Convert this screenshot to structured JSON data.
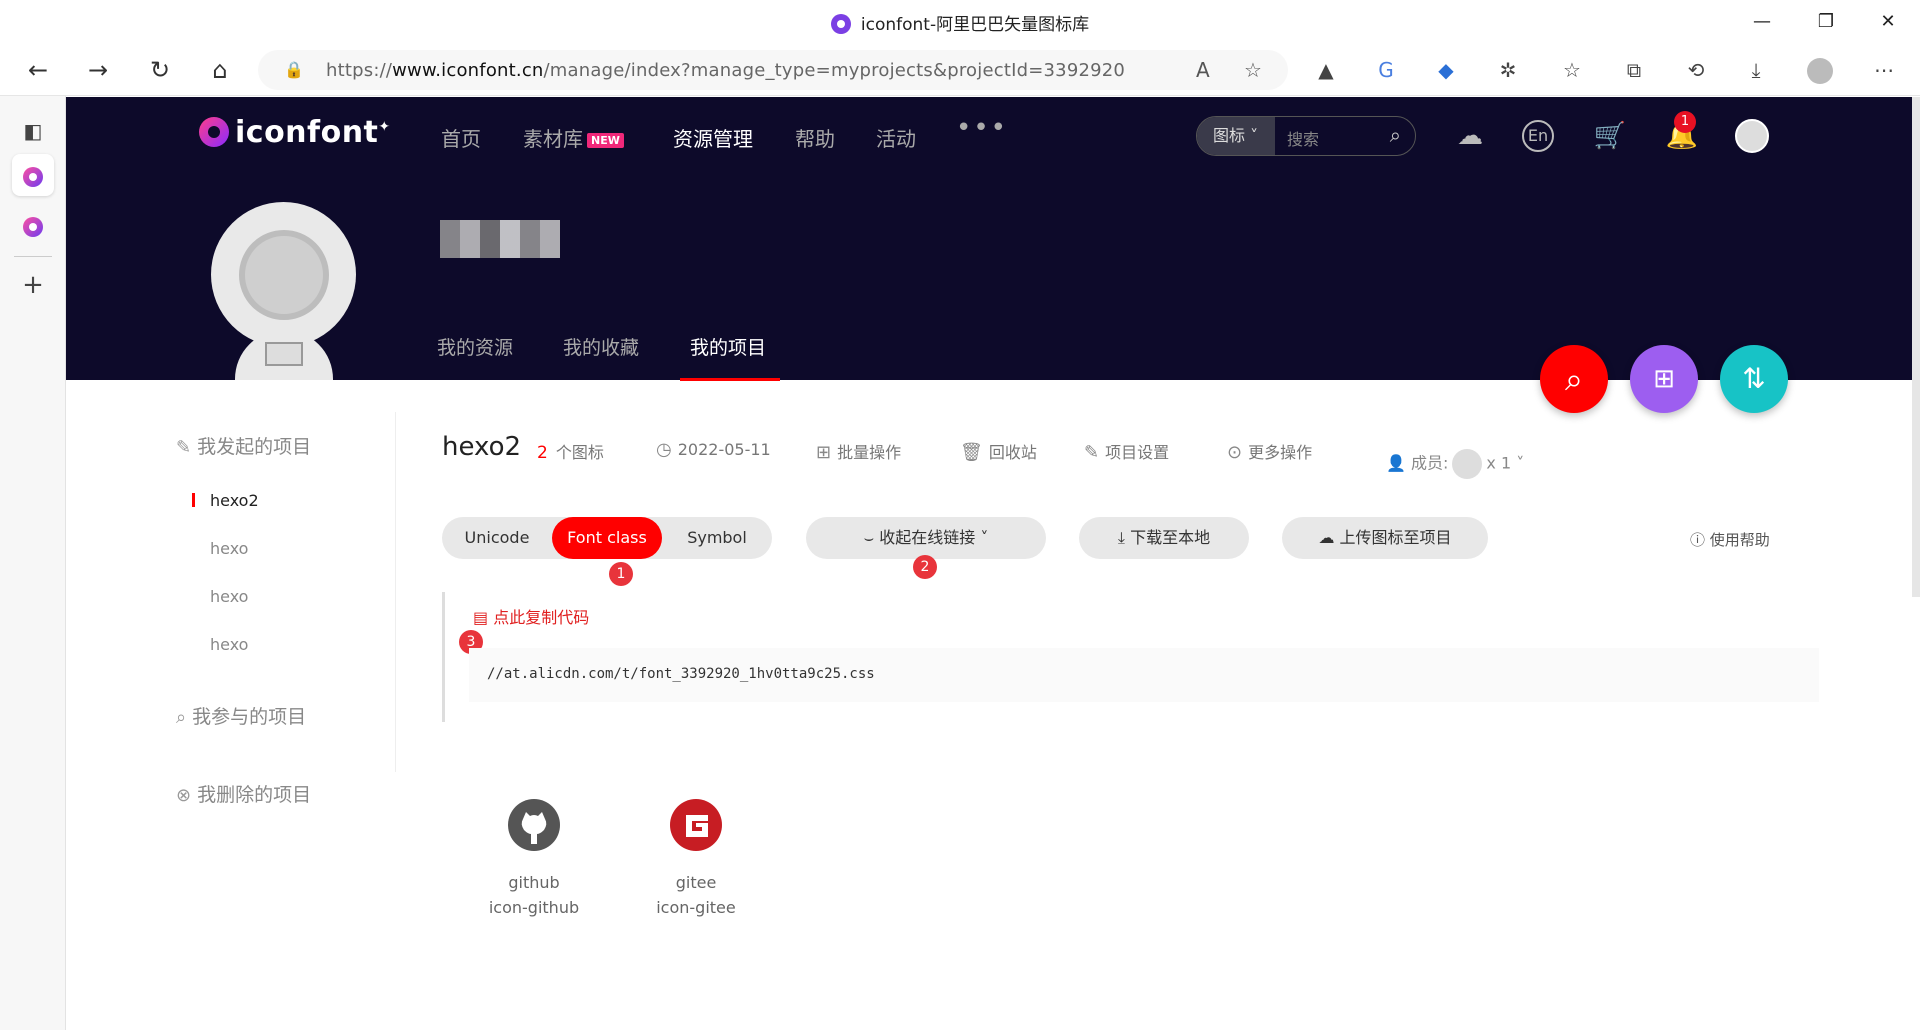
{
  "window": {
    "title": "iconfont-阿里巴巴矢量图标库"
  },
  "address_bar": {
    "url_prefix": "https://",
    "url_host": "www.iconfont.cn",
    "url_path": "/manage/index?manage_type=myprojects&projectId=3392920"
  },
  "site": {
    "logo_text": "iconfont",
    "nav": [
      "首页",
      "素材库",
      "资源管理",
      "帮助",
      "活动"
    ],
    "new_tag": "NEW",
    "more": "•••",
    "search_select": "图标",
    "search_placeholder": "搜索",
    "notification_count": "1",
    "lang_label": "En"
  },
  "profile": {
    "tabs": [
      "我的资源",
      "我的收藏",
      "我的项目"
    ]
  },
  "sidebar": {
    "initiated_heading": "我发起的项目",
    "projects": [
      "hexo2",
      "hexo",
      "hexo",
      "hexo"
    ],
    "participated_heading": "我参与的项目",
    "deleted_heading": "我删除的项目"
  },
  "project": {
    "name": "hexo2",
    "icon_count": "2",
    "icon_count_unit": "个图标",
    "date": "2022-05-11",
    "actions": [
      "批量操作",
      "回收站",
      "项目设置",
      "更多操作"
    ],
    "members_label": "成员:",
    "members_count": "x 1"
  },
  "toolbar": {
    "segments": [
      "Unicode",
      "Font class",
      "Symbol"
    ],
    "collapse_link": "收起在线链接",
    "download": "下载至本地",
    "upload": "上传图标至项目",
    "help": "使用帮助"
  },
  "markers": [
    "1",
    "2",
    "3"
  ],
  "code": {
    "copy_label": "点此复制代码",
    "url": "//at.alicdn.com/t/font_3392920_1hv0tta9c25.css"
  },
  "icons": [
    {
      "name": "github",
      "class": "icon-github"
    },
    {
      "name": "gitee",
      "class": "icon-gitee"
    }
  ],
  "colors": {
    "accent": "#ff0000",
    "header_bg": "#0d0a2a",
    "fab_search": "#ff0000",
    "fab_folder": "#9d5ef0",
    "fab_sort": "#17c3c6"
  }
}
